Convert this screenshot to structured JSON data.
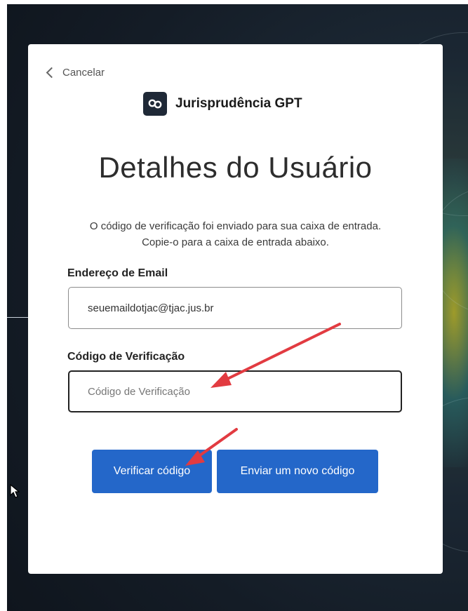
{
  "page": {
    "cancel_label": "Cancelar",
    "brand_name": "Jurisprudência GPT",
    "title": "Detalhes do Usuário",
    "info_text": "O código de verificação foi enviado para sua caixa de entrada. Copie-o para a caixa de entrada abaixo."
  },
  "form": {
    "email_label": "Endereço de Email",
    "email_value": "seuemaildotjac@tjac.jus.br",
    "code_label": "Código de Verificação",
    "code_placeholder": "Código de Verificação",
    "code_value": ""
  },
  "buttons": {
    "verify_label": "Verificar código",
    "resend_label": "Enviar um novo código"
  },
  "icons": {
    "back": "chevron-left-icon",
    "logo": "jurisprudencia-logo-icon",
    "annotation": "red-arrow-icon",
    "pointer": "mouse-cursor-icon"
  },
  "colors": {
    "primary_button": "#2467c9",
    "logo_bg": "#1f2937",
    "annotation_arrow": "#e23b41",
    "backdrop": "#141c26"
  }
}
